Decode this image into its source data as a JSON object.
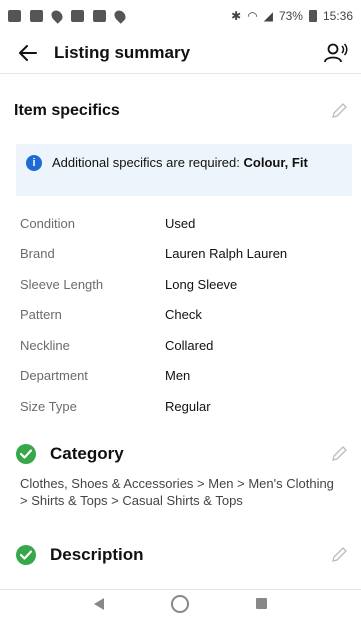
{
  "status_bar": {
    "battery": "73%",
    "time": "15:36"
  },
  "header": {
    "title": "Listing summary"
  },
  "item_specifics": {
    "title": "Item specifics",
    "notice_text": "Additional specifics are required: ",
    "notice_bold": "Colour, Fit",
    "rows": [
      {
        "label": "Condition",
        "value": "Used"
      },
      {
        "label": "Brand",
        "value": "Lauren Ralph Lauren"
      },
      {
        "label": "Sleeve Length",
        "value": "Long Sleeve"
      },
      {
        "label": "Pattern",
        "value": "Check"
      },
      {
        "label": "Neckline",
        "value": "Collared"
      },
      {
        "label": "Department",
        "value": "Men"
      },
      {
        "label": "Size Type",
        "value": "Regular"
      }
    ]
  },
  "category": {
    "title": "Category",
    "path": "Clothes, Shoes & Accessories > Men > Men's Clothing > Shirts & Tops > Casual Shirts & Tops"
  },
  "description": {
    "title": "Description"
  },
  "colors": {
    "accent_blue": "#1e6bd6",
    "check_green": "#36a84a",
    "notice_bg": "#eef4fb"
  }
}
